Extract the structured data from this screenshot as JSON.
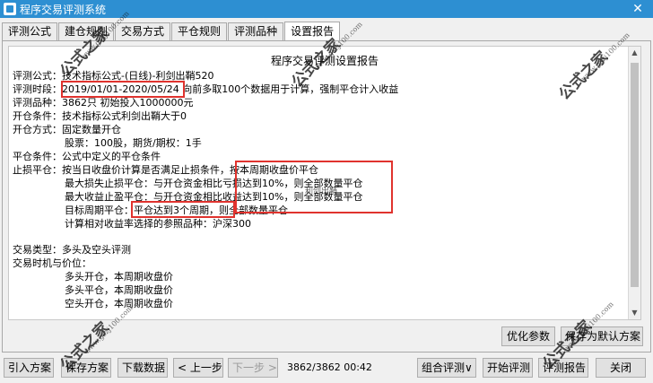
{
  "window": {
    "title": "程序交易评测系统"
  },
  "tabs": [
    "评测公式",
    "建仓规则",
    "交易方式",
    "平仓规则",
    "评测品种",
    "设置报告"
  ],
  "report": {
    "title": "程序交易评测设置报告",
    "lines": [
      "评测公式：技术指标公式-(日线)-利剑出鞘520",
      "评测时段：2019/01/01-2020/05/24  向前多取100个数据用于计算，强制平仓计入收益",
      "评测品种：3862只  初始投入1000000元",
      "开仓条件：技术指标公式利剑出鞘大于0",
      "开仓方式：固定数量开仓",
      "股票：100股，期货/期权：1手",
      "平仓条件：公式中定义的平仓条件",
      "止损平仓：按当日收盘价计算是否满足止损条件，按本周期收盘价平仓",
      "最大损失止损平仓：与开仓资金相比亏损达到10%，则全部数量平仓",
      "最大收益止盈平仓：与开仓资金相比收益达到10%，则全部数量平仓",
      "目标周期平仓：平仓达到3个周期，则全部数量平仓",
      "计算相对收益率选择的参照品种：沪深300",
      "交易类型：多头及空头评测",
      "交易时机与价位：",
      "多头开仓，本周期收盘价",
      "多头平仓，本周期收盘价",
      "空头开仓，本周期收盘价"
    ]
  },
  "buttons": {
    "optimize": "优化参数",
    "save_default": "保存为默认方案",
    "import_plan": "引入方案",
    "save_plan": "保存方案",
    "download_data": "下载数据",
    "prev_step": "< 上一步",
    "next_step": "下一步 >",
    "combo_eval": "组合评测∨",
    "start_eval": "开始评测",
    "eval_report": "评测报告",
    "close": "关闭"
  },
  "status": {
    "progress_text": "3862/3862  00:42"
  },
  "watermark": {
    "text": "公式之家",
    "url": "www.gszj100.com",
    "tooltip": "利剑出鞘"
  }
}
